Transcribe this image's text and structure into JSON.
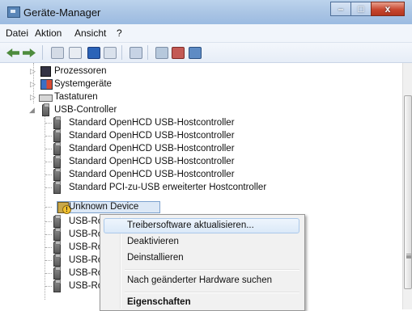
{
  "window": {
    "title": "Geräte-Manager",
    "minimize": "–",
    "maximize": "□",
    "close": "x"
  },
  "menu": [
    {
      "label": "Datei"
    },
    {
      "label": "Aktion"
    },
    {
      "label": "Ansicht"
    },
    {
      "label": "?"
    }
  ],
  "toolbar": {
    "icons": [
      "back-icon",
      "forward-icon",
      "properties-icon",
      "view-icon",
      "help-icon",
      "details-icon",
      "scan-icon",
      "update-driver-icon",
      "disable-icon",
      "uninstall-icon"
    ]
  },
  "tree": {
    "top": [
      {
        "label": "Prozessoren",
        "icon": "processor-icon"
      },
      {
        "label": "Systemgeräte",
        "icon": "system-devices-icon"
      },
      {
        "label": "Tastaturen",
        "icon": "keyboard-icon"
      }
    ],
    "usb": {
      "label": "USB-Controller",
      "children": [
        "Standard OpenHCD USB-Hostcontroller",
        "Standard OpenHCD USB-Hostcontroller",
        "Standard OpenHCD USB-Hostcontroller",
        "Standard OpenHCD USB-Hostcontroller",
        "Standard OpenHCD USB-Hostcontroller",
        "Standard PCI-zu-USB erweiterter Hostcontroller",
        "Unknown Device",
        "USB-Roo",
        "USB-Roo",
        "USB-Roo",
        "USB-Roo",
        "USB-Roo",
        "USB-Roo"
      ]
    }
  },
  "context_menu": {
    "items": [
      "Treibersoftware aktualisieren...",
      "Deaktivieren",
      "Deinstallieren",
      "Nach geänderter Hardware suchen",
      "Eigenschaften"
    ]
  }
}
